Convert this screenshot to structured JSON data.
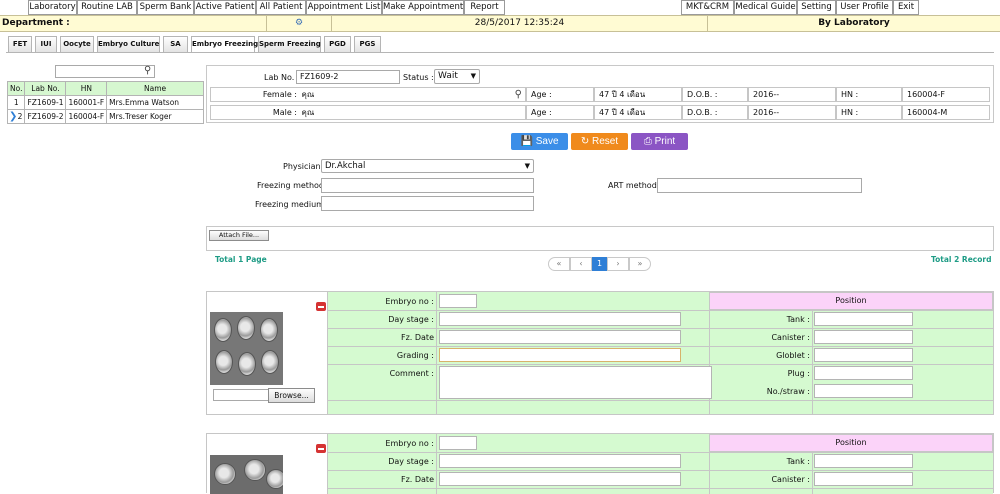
{
  "menu": [
    "Laboratory",
    "Routine LAB",
    "Sperm Bank",
    "Active Patient",
    "All Patient",
    "Appointment List",
    "Make Appointment",
    "Report",
    "MKT&CRM",
    "Medical Guide",
    "Setting",
    "User Profile",
    "Exit"
  ],
  "dept_bar": {
    "label": "Department :",
    "datetime": "28/5/2017 12:35:24",
    "by": "By Laboratory"
  },
  "tabs": [
    "FET",
    "IUI",
    "Oocyte",
    "Embryo Culture",
    "SA",
    "Embryo Freezing",
    "Sperm Freezing",
    "PGD",
    "PGS"
  ],
  "active_tab": "Embryo Freezing",
  "list": {
    "headers": [
      "No.",
      "Lab No.",
      "HN",
      "Name"
    ],
    "rows": [
      {
        "no": "1",
        "lab": "FZ1609-1",
        "hn": "160001-F",
        "name": "Mrs.Emma Watson"
      },
      {
        "no": "2",
        "lab": "FZ1609-2",
        "hn": "160004-F",
        "name": "Mrs.Treser Koger"
      }
    ]
  },
  "info": {
    "lab_no_label": "Lab No. :",
    "lab_no": "FZ1609-2",
    "status_label": "Status :",
    "status": "Wait",
    "female_label": "Female :",
    "female_name": "คุณ",
    "male_label": "Male :",
    "male_name": "คุณ",
    "age_label": "Age :",
    "female_age": "47 ปี 4 เดือน",
    "male_age": "47 ปี 4 เดือน",
    "dob_label": "D.O.B. :",
    "female_dob": "2016--",
    "male_dob": "2016--",
    "hn_label": "HN :",
    "female_hn": "160004-F",
    "male_hn": "160004-M"
  },
  "buttons": {
    "save": "Save",
    "reset": "Reset",
    "print": "Print",
    "attach": "Attach File...",
    "browse": "Browse..."
  },
  "form": {
    "physician_label": "Physician :",
    "physician": "Dr.Akchal",
    "freezing_method_label": "Freezing method :",
    "art_method_label": "ART method :",
    "freezing_medium_label": "Freezing medium :"
  },
  "pagination": {
    "total_page": "Total 1 Page",
    "total_record": "Total 2 Record",
    "current": "1",
    "first": "«",
    "prev": "‹",
    "next": "›",
    "last": "»"
  },
  "embryo": {
    "embryo_no_label": "Embryo no :",
    "day_stage_label": "Day stage :",
    "fz_date_label": "Fz. Date",
    "grading_label": "Grading :",
    "comment_label": "Comment :",
    "position_label": "Position",
    "tank_label": "Tank :",
    "canister_label": "Canister :",
    "goblet_label": "Globlet :",
    "plug_label": "Plug :",
    "straw_label": "No./straw :"
  },
  "colors": {
    "save": "#3b8ee8",
    "reset": "#f08a1c",
    "print": "#8b55c4",
    "accent_green": "#d5fad0",
    "accent_pink": "#fbd3f9",
    "dept_bar": "#fffbd3",
    "teal": "#1f9c86"
  }
}
